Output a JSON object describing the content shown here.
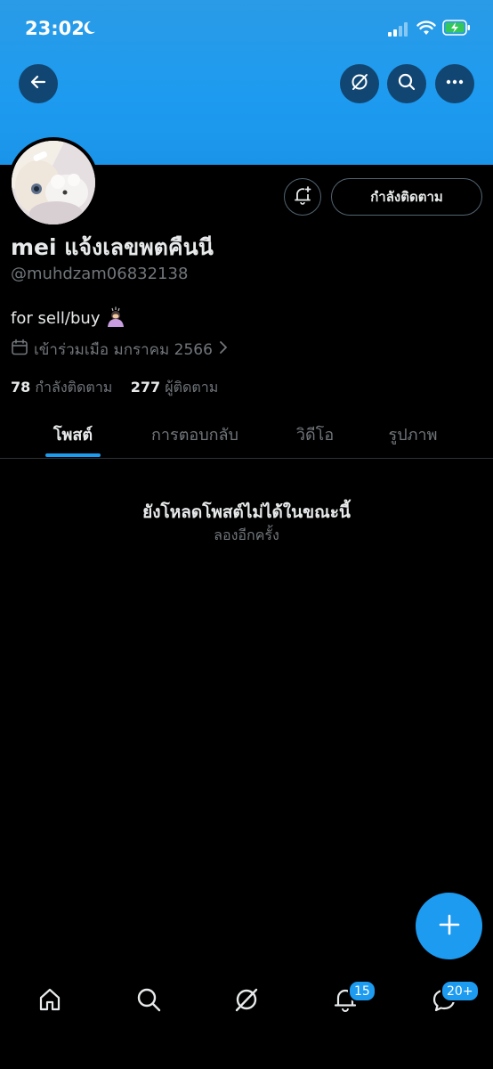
{
  "status_bar": {
    "time": "23:02"
  },
  "profile": {
    "display_name": "mei แจ้งเลขพตคืนนี",
    "handle": "@muhdzam06832138",
    "bio": "for sell/buy",
    "joined": "เข้าร่วมเมือ มกราคม 2566",
    "following_count": "78",
    "following_label": "กำลังติดตาม",
    "followers_count": "277",
    "followers_label": "ผู้ติดตาม",
    "follow_button_label": "กำลังติดตาม"
  },
  "tabs": [
    {
      "label": "โพสต์",
      "active": true
    },
    {
      "label": "การตอบกลับ",
      "active": false
    },
    {
      "label": "วิดีโอ",
      "active": false
    },
    {
      "label": "รูปภาพ",
      "active": false
    }
  ],
  "empty_state": {
    "title": "ยังโหลดโพสต์ไม่ได้ในขณะนี้",
    "retry": "ลองอีกครั้ง"
  },
  "bottom_nav": {
    "items": [
      "home-icon",
      "search-icon",
      "grok-icon",
      "notifications-icon",
      "messages-icon"
    ],
    "notifications_badge": "15",
    "messages_badge": "20+"
  },
  "colors": {
    "accent": "#1d9bf0",
    "background": "#000000",
    "secondary_text": "#71767b"
  }
}
